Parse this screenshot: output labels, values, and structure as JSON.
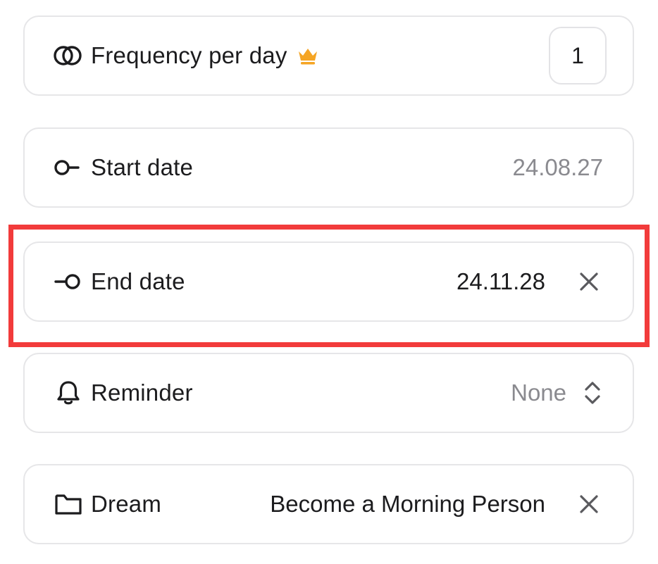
{
  "rows": {
    "frequency": {
      "label": "Frequency per day",
      "value": "1",
      "icon": "overlapping-circles-icon",
      "badge_icon": "crown-icon",
      "badge_color": "#F5A524"
    },
    "start_date": {
      "label": "Start date",
      "value": "24.08.27",
      "icon": "start-date-icon"
    },
    "end_date": {
      "label": "End date",
      "value": "24.11.28",
      "icon": "end-date-icon",
      "action_icon": "close-icon"
    },
    "reminder": {
      "label": "Reminder",
      "value": "None",
      "icon": "bell-icon",
      "action_icon": "chevron-up-down-icon"
    },
    "dream": {
      "label": "Dream",
      "value": "Become a Morning Person",
      "icon": "folder-icon",
      "action_icon": "close-icon"
    }
  },
  "highlight_color": "#F23B3B"
}
